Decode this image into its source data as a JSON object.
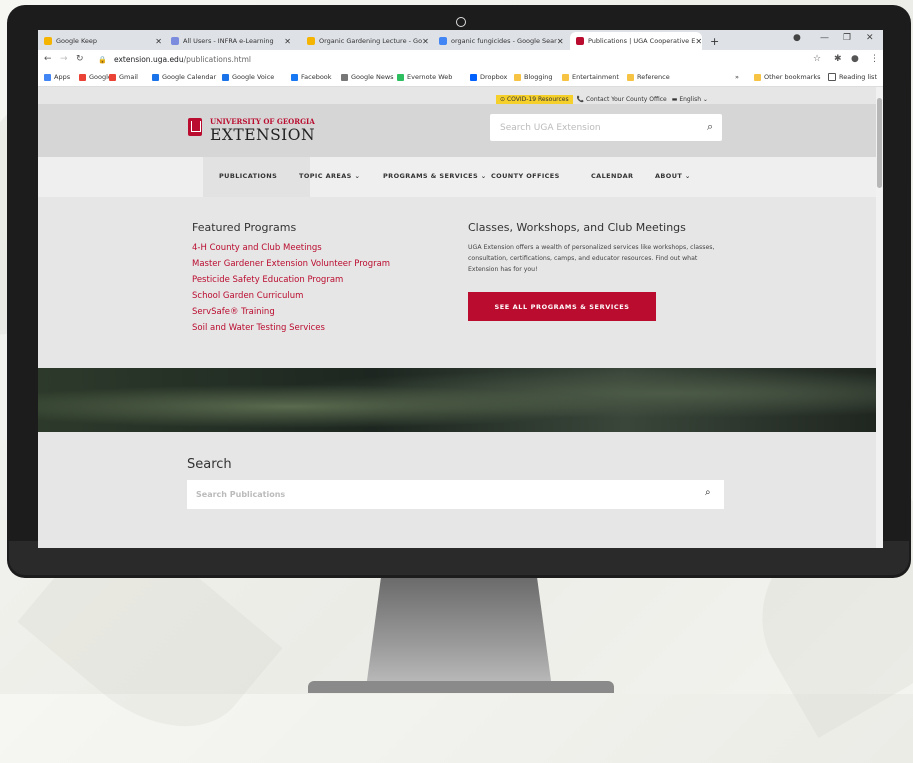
{
  "tabs": [
    {
      "label": "Google Keep",
      "color": "#f4b400"
    },
    {
      "label": "All Users - INFRA e-Learning",
      "color": "#7b8cde"
    },
    {
      "label": "Organic Gardening Lecture - Go",
      "color": "#f4b400"
    },
    {
      "label": "organic fungicides - Google Sear",
      "color": "#4285f4"
    },
    {
      "label": "Publications | UGA Cooperative E",
      "color": "#ba0c2f"
    }
  ],
  "tab_close": "✕",
  "new_tab": "+",
  "address": {
    "domain": "extension.uga.edu",
    "path": "/publications.html"
  },
  "bookmarks": [
    {
      "label": "Apps",
      "color": "#4285f4"
    },
    {
      "label": "Google",
      "color": "#ea4335"
    },
    {
      "label": "Gmail",
      "color": "#ea4335"
    },
    {
      "label": "Google Calendar",
      "color": "#1a73e8"
    },
    {
      "label": "Google Voice",
      "color": "#1a73e8"
    },
    {
      "label": "Facebook",
      "color": "#1877f2"
    },
    {
      "label": "Google News",
      "color": "#777"
    },
    {
      "label": "Evernote Web",
      "color": "#2dbe60"
    },
    {
      "label": "Dropbox",
      "color": "#0061fe"
    },
    {
      "label": "Blogging",
      "color": "#f6c342"
    },
    {
      "label": "Entertainment",
      "color": "#f6c342"
    },
    {
      "label": "Reference",
      "color": "#f6c342"
    }
  ],
  "bookmarks_right": {
    "more": "»",
    "other": "Other bookmarks",
    "reading": "Reading list"
  },
  "utility": {
    "covid": "COVID-19 Resources",
    "contact": "Contact Your County Office",
    "language": "English"
  },
  "logo": {
    "university": "UNIVERSITY OF GEORGIA",
    "extension": "EXTENSION"
  },
  "header_search": {
    "placeholder": "Search UGA Extension"
  },
  "nav": [
    {
      "label": "PUBLICATIONS"
    },
    {
      "label": "TOPIC AREAS",
      "dropdown": true
    },
    {
      "label": "PROGRAMS & SERVICES",
      "dropdown": true
    },
    {
      "label": "COUNTY OFFICES"
    },
    {
      "label": "CALENDAR"
    },
    {
      "label": "ABOUT",
      "dropdown": true
    }
  ],
  "featured": {
    "title": "Featured Programs",
    "links": [
      "4-H County and Club Meetings",
      "Master Gardener Extension Volunteer Program",
      "Pesticide Safety Education Program",
      "School Garden Curriculum",
      "ServSafe® Training",
      "Soil and Water Testing Services"
    ]
  },
  "classes": {
    "title": "Classes, Workshops, and Club Meetings",
    "description": "UGA Extension offers a wealth of personalized services like workshops, classes, consultation, certifications, camps, and educator resources. Find out what Extension has for you!",
    "button": "SEE ALL PROGRAMS & SERVICES"
  },
  "search_section": {
    "title": "Search",
    "placeholder": "Search Publications"
  },
  "colors": {
    "brand_red": "#ba0c2f",
    "covid_yellow": "#f5cf2a"
  }
}
